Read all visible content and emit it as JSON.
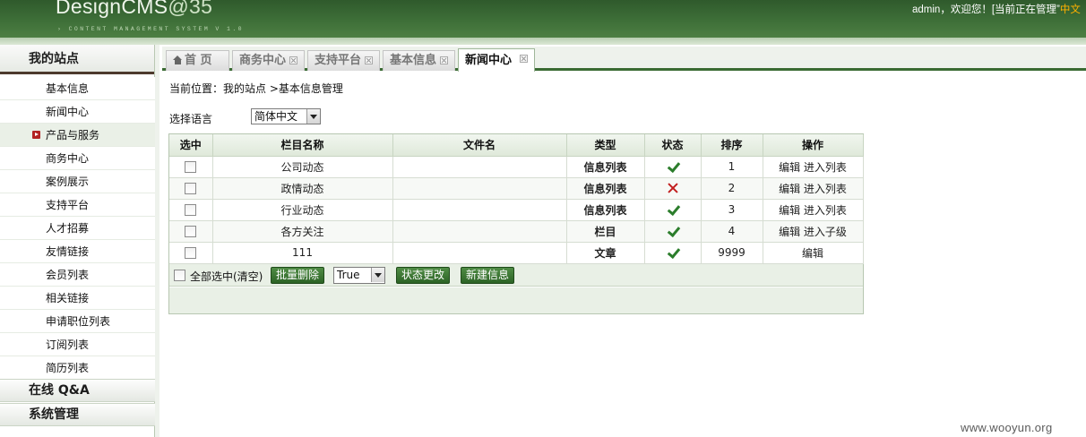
{
  "header": {
    "logo_text": "DesignCMS",
    "logo_suffix": "@35",
    "tagline": "› CONTENT MANAGEMENT SYSTEM V 1.0",
    "welcome": "admin，欢迎您！[当前正在管理”",
    "welcome_highlight": "中文"
  },
  "sidebar": {
    "title": "我的站点",
    "items": [
      {
        "label": "基本信息"
      },
      {
        "label": "新闻中心"
      },
      {
        "label": "产品与服务"
      },
      {
        "label": "商务中心"
      },
      {
        "label": "案例展示"
      },
      {
        "label": "支持平台"
      },
      {
        "label": "人才招募"
      },
      {
        "label": "友情链接"
      },
      {
        "label": "会员列表"
      },
      {
        "label": "相关链接"
      },
      {
        "label": "申请职位列表"
      },
      {
        "label": "订阅列表"
      },
      {
        "label": "简历列表"
      }
    ],
    "active_index": 2,
    "sections": [
      {
        "label": "在线 Q&A"
      },
      {
        "label": "系统管理"
      }
    ]
  },
  "tabs": [
    {
      "label": "首 页",
      "icon": "home-icon",
      "closable": false
    },
    {
      "label": "商务中心",
      "closable": true
    },
    {
      "label": "支持平台",
      "closable": true
    },
    {
      "label": "基本信息",
      "closable": true
    },
    {
      "label": "新闻中心",
      "closable": true,
      "active": true
    }
  ],
  "content": {
    "breadcrumb": "当前位置：我的站点 >基本信息管理",
    "language_label": "选择语言",
    "language_value": "简体中文",
    "table": {
      "headers": [
        "选中",
        "栏目名称",
        "文件名",
        "类型",
        "状态",
        "排序",
        "操作"
      ],
      "rows": [
        {
          "name": "公司动态",
          "file": "",
          "type": "信息列表",
          "type_color": "blue",
          "status": "check",
          "order": "1",
          "actions": "编辑 进入列表"
        },
        {
          "name": "政情动态",
          "file": "",
          "type": "信息列表",
          "type_color": "blue",
          "status": "cross",
          "order": "2",
          "actions": "编辑 进入列表"
        },
        {
          "name": "行业动态",
          "file": "",
          "type": "信息列表",
          "type_color": "blue",
          "status": "check",
          "order": "3",
          "actions": "编辑 进入列表"
        },
        {
          "name": "各方关注",
          "file": "",
          "type": "栏目",
          "type_color": "red",
          "status": "check",
          "order": "4",
          "actions": "编辑 进入子级"
        },
        {
          "name": "111",
          "file": "",
          "type": "文章",
          "type_color": "blue",
          "status": "check",
          "order": "9999",
          "actions": "编辑"
        }
      ]
    },
    "toolbar": {
      "select_all_label": "全部选中(清空)",
      "batch_delete": "批量删除",
      "status_value": "True",
      "status_change": "状态更改",
      "new_info": "新建信息"
    }
  },
  "watermark": "www.wooyun.org",
  "colors": {
    "header_green": "#3e6f38",
    "accent_green": "#3a6b33",
    "type_blue": "#1b2f8f",
    "type_red": "#c4141c",
    "check_green": "#2b7d2b",
    "cross_red": "#c21f1f"
  }
}
